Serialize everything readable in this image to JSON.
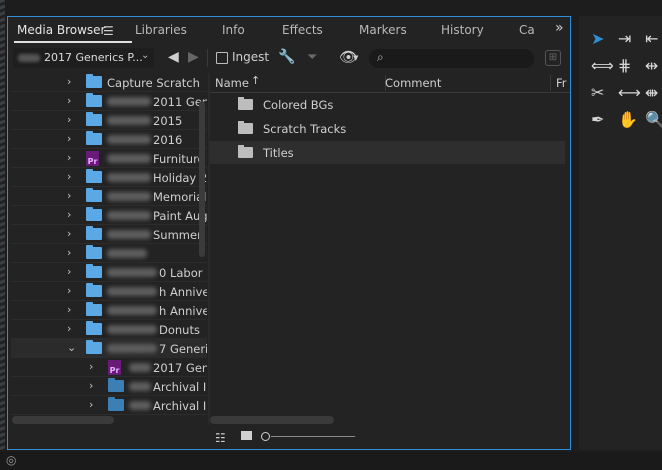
{
  "tabs": [
    {
      "label": "Media Browser",
      "active": true
    },
    {
      "label": "Libraries"
    },
    {
      "label": "Info"
    },
    {
      "label": "Effects"
    },
    {
      "label": "Markers"
    },
    {
      "label": "History"
    },
    {
      "label": "Ca"
    }
  ],
  "tab_menu_icon": "hamburger-menu-icon",
  "tab_overflow_icon": "chevron-double-right-icon",
  "toolbar": {
    "location": "2017 Generics P...",
    "ingest_label": "Ingest",
    "search_value": "",
    "icons": [
      "back-arrow-icon",
      "forward-arrow-icon",
      "wrench-icon",
      "filter-icon",
      "eye-icon",
      "search-icon",
      "network-link-icon"
    ]
  },
  "tree": [
    {
      "label": "Capture Scratch",
      "icon": "folder",
      "indent": 0,
      "expanded": false
    },
    {
      "label": "2011 Gen",
      "icon": "folder",
      "indent": 0,
      "expanded": false
    },
    {
      "label": "2015",
      "icon": "folder",
      "indent": 0,
      "expanded": false
    },
    {
      "label": "2016",
      "icon": "folder",
      "indent": 0,
      "expanded": false
    },
    {
      "label": "Furniture",
      "icon": "premiere-project",
      "indent": 0,
      "expanded": false
    },
    {
      "label": "Holiday 2",
      "icon": "folder",
      "indent": 0,
      "expanded": false
    },
    {
      "label": "Memorial",
      "icon": "folder",
      "indent": 0,
      "expanded": false
    },
    {
      "label": "Paint Aug",
      "icon": "folder",
      "indent": 0,
      "expanded": false
    },
    {
      "label": "Summer",
      "icon": "folder",
      "indent": 0,
      "expanded": false
    },
    {
      "label": "",
      "icon": "folder",
      "indent": 0,
      "expanded": false
    },
    {
      "label": "0 Labor Da",
      "icon": "folder",
      "indent": 0,
      "expanded": false
    },
    {
      "label": "h Anniver",
      "icon": "folder",
      "indent": 0,
      "expanded": false
    },
    {
      "label": "h Anniver",
      "icon": "folder",
      "indent": 0,
      "expanded": false
    },
    {
      "label": "Donuts",
      "icon": "folder",
      "indent": 0,
      "expanded": false
    },
    {
      "label": "7 Generics",
      "icon": "folder",
      "indent": 0,
      "expanded": true
    },
    {
      "label": "2017 Gen",
      "icon": "premiere-project",
      "indent": 1,
      "expanded": false
    },
    {
      "label": "Archival I",
      "icon": "folder",
      "indent": 1,
      "expanded": false
    },
    {
      "label": "Archival I",
      "icon": "folder",
      "indent": 1,
      "expanded": false
    }
  ],
  "list": {
    "columns": {
      "name": "Name",
      "comment": "Comment",
      "extra": "Fr"
    },
    "sort_icon": "sort-ascending-icon",
    "items": [
      {
        "label": "Colored BGs",
        "icon": "folder-icon"
      },
      {
        "label": "Scratch Tracks",
        "icon": "folder-icon"
      },
      {
        "label": "Titles",
        "icon": "folder-icon"
      }
    ]
  },
  "bottombar": {
    "icons": [
      "list-view-icon",
      "icon-view-icon",
      "zoom-slider"
    ]
  },
  "tools": [
    {
      "name": "selection-tool",
      "glyph": "➤",
      "active": true
    },
    {
      "name": "track-select-tool",
      "glyph": "⇥"
    },
    {
      "name": "track-select-backward-tool",
      "glyph": "⇤"
    },
    {
      "name": "ripple-edit-tool",
      "glyph": "⟺"
    },
    {
      "name": "rolling-edit-tool",
      "glyph": "⋕"
    },
    {
      "name": "rate-stretch-tool",
      "glyph": "⇹"
    },
    {
      "name": "razor-tool",
      "glyph": "✂"
    },
    {
      "name": "slip-tool",
      "glyph": "⟷"
    },
    {
      "name": "slide-tool",
      "glyph": "⇼"
    },
    {
      "name": "pen-tool",
      "glyph": "✒"
    },
    {
      "name": "hand-tool",
      "glyph": "✋"
    },
    {
      "name": "zoom-tool",
      "glyph": "🔍"
    }
  ],
  "colors": {
    "accent": "#2e8fd8",
    "folder": "#5aa9e6",
    "project": "#6a1b7a",
    "background": "#232323"
  }
}
